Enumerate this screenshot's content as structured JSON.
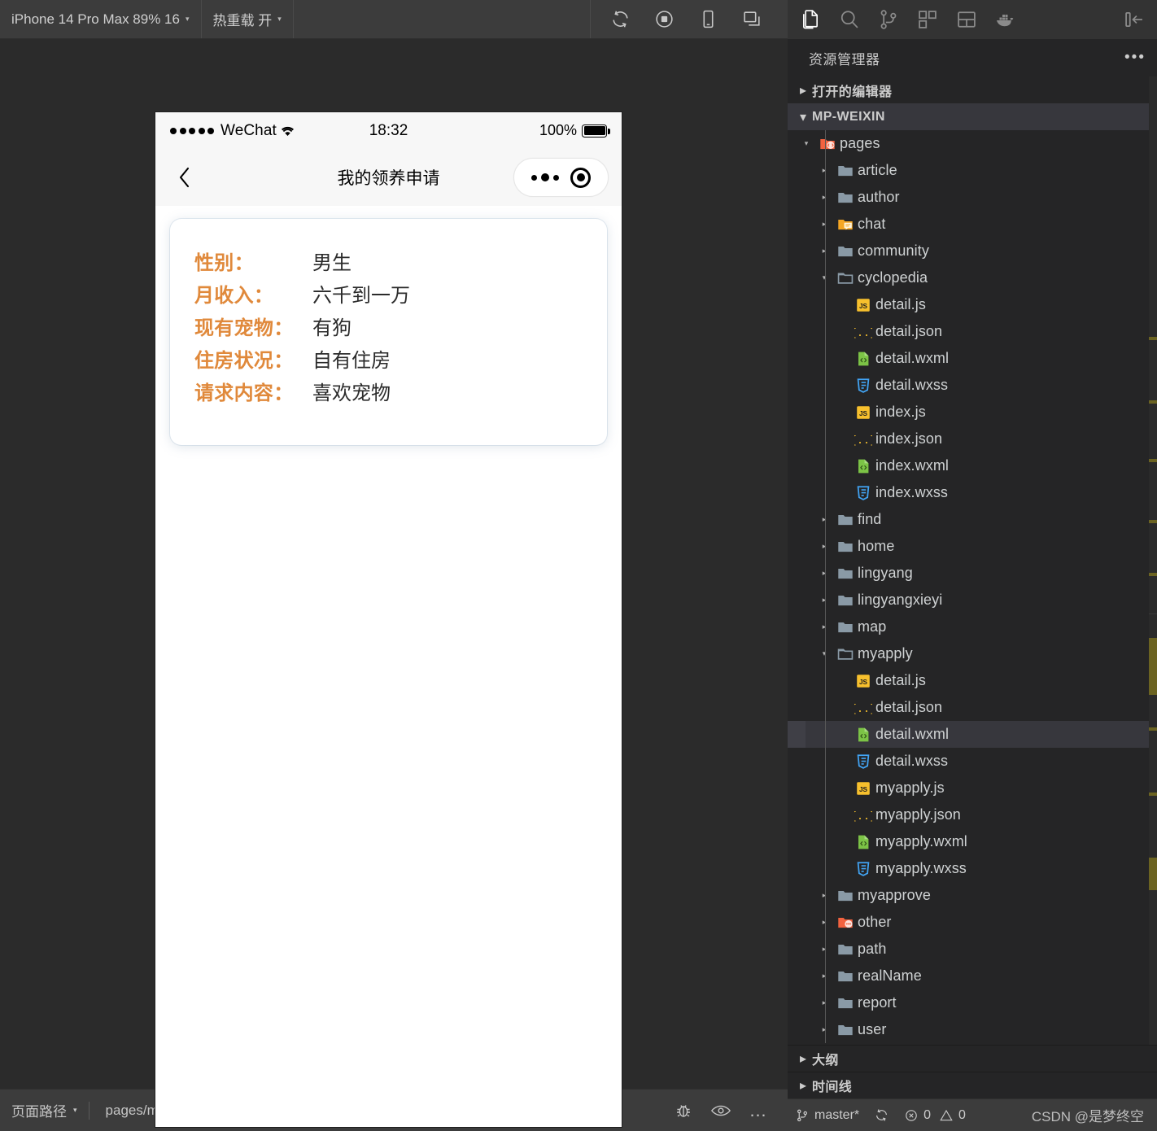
{
  "simulator": {
    "toolbar": {
      "device_label": "iPhone 14 Pro Max 89% 16",
      "hotreload_label": "热重载 开",
      "caret": "▾",
      "icons": [
        {
          "name": "refresh-icon",
          "glyph": "refresh"
        },
        {
          "name": "stop-recording-icon",
          "glyph": "stop"
        },
        {
          "name": "device-preview-icon",
          "glyph": "phone"
        },
        {
          "name": "multi-window-icon",
          "glyph": "windows"
        }
      ]
    },
    "phone": {
      "status_bar": {
        "carrier": "WeChat",
        "time": "18:32",
        "battery_percent": "100%"
      },
      "nav_bar": {
        "title": "我的领养申请"
      },
      "card": {
        "rows": [
          {
            "label": "性别：",
            "value": "男生"
          },
          {
            "label": "月收入：",
            "value": "六千到一万"
          },
          {
            "label": "现有宠物：",
            "value": "有狗"
          },
          {
            "label": "住房状况：",
            "value": "自有住房"
          },
          {
            "label": "请求内容：",
            "value": "喜欢宠物"
          }
        ],
        "label_color": "#e0893b",
        "value_color": "#2b2b2b"
      }
    },
    "status_bar": {
      "page_path_label": "页面路径",
      "caret": "▾",
      "page_path_value": "pages/myapply/myapply",
      "icons": [
        {
          "name": "debug-bug-icon"
        },
        {
          "name": "eye-visibility-icon"
        },
        {
          "name": "more-options-icon",
          "glyph": "…"
        }
      ]
    }
  },
  "vscode": {
    "activity_bar": {
      "items": [
        {
          "name": "explorer-icon",
          "active": true
        },
        {
          "name": "search-icon",
          "active": false
        },
        {
          "name": "source-control-icon",
          "active": false
        },
        {
          "name": "extensions-icon",
          "active": false
        },
        {
          "name": "split-layout-icon",
          "active": false
        },
        {
          "name": "docker-icon",
          "active": false
        }
      ],
      "collapse_icon": "collapse-panel-icon"
    },
    "explorer": {
      "title": "资源管理器",
      "more_glyph": "•••",
      "open_editors_label": "打开的编辑器",
      "workspace_label": "MP-WEIXIN",
      "outline_label": "大纲",
      "timeline_label": "时间线"
    },
    "tree": [
      {
        "depth": 1,
        "label": "pages",
        "kind": "folder",
        "icon": "folder-pages",
        "expanded": true
      },
      {
        "depth": 2,
        "label": "article",
        "kind": "folder",
        "icon": "folder",
        "expanded": false
      },
      {
        "depth": 2,
        "label": "author",
        "kind": "folder",
        "icon": "folder",
        "expanded": false
      },
      {
        "depth": 2,
        "label": "chat",
        "kind": "folder",
        "icon": "folder-chat",
        "expanded": false
      },
      {
        "depth": 2,
        "label": "community",
        "kind": "folder",
        "icon": "folder",
        "expanded": false
      },
      {
        "depth": 2,
        "label": "cyclopedia",
        "kind": "folder",
        "icon": "folder-open",
        "expanded": true
      },
      {
        "depth": 3,
        "label": "detail.js",
        "kind": "file",
        "icon": "js"
      },
      {
        "depth": 3,
        "label": "detail.json",
        "kind": "file",
        "icon": "json"
      },
      {
        "depth": 3,
        "label": "detail.wxml",
        "kind": "file",
        "icon": "wxml"
      },
      {
        "depth": 3,
        "label": "detail.wxss",
        "kind": "file",
        "icon": "wxss"
      },
      {
        "depth": 3,
        "label": "index.js",
        "kind": "file",
        "icon": "js"
      },
      {
        "depth": 3,
        "label": "index.json",
        "kind": "file",
        "icon": "json"
      },
      {
        "depth": 3,
        "label": "index.wxml",
        "kind": "file",
        "icon": "wxml"
      },
      {
        "depth": 3,
        "label": "index.wxss",
        "kind": "file",
        "icon": "wxss"
      },
      {
        "depth": 2,
        "label": "find",
        "kind": "folder",
        "icon": "folder",
        "expanded": false
      },
      {
        "depth": 2,
        "label": "home",
        "kind": "folder",
        "icon": "folder",
        "expanded": false
      },
      {
        "depth": 2,
        "label": "lingyang",
        "kind": "folder",
        "icon": "folder",
        "expanded": false
      },
      {
        "depth": 2,
        "label": "lingyangxieyi",
        "kind": "folder",
        "icon": "folder",
        "expanded": false
      },
      {
        "depth": 2,
        "label": "map",
        "kind": "folder",
        "icon": "folder",
        "expanded": false
      },
      {
        "depth": 2,
        "label": "myapply",
        "kind": "folder",
        "icon": "folder-open",
        "expanded": true
      },
      {
        "depth": 3,
        "label": "detail.js",
        "kind": "file",
        "icon": "js"
      },
      {
        "depth": 3,
        "label": "detail.json",
        "kind": "file",
        "icon": "json"
      },
      {
        "depth": 3,
        "label": "detail.wxml",
        "kind": "file",
        "icon": "wxml",
        "selected": true
      },
      {
        "depth": 3,
        "label": "detail.wxss",
        "kind": "file",
        "icon": "wxss"
      },
      {
        "depth": 3,
        "label": "myapply.js",
        "kind": "file",
        "icon": "js"
      },
      {
        "depth": 3,
        "label": "myapply.json",
        "kind": "file",
        "icon": "json"
      },
      {
        "depth": 3,
        "label": "myapply.wxml",
        "kind": "file",
        "icon": "wxml"
      },
      {
        "depth": 3,
        "label": "myapply.wxss",
        "kind": "file",
        "icon": "wxss"
      },
      {
        "depth": 2,
        "label": "myapprove",
        "kind": "folder",
        "icon": "folder",
        "expanded": false
      },
      {
        "depth": 2,
        "label": "other",
        "kind": "folder",
        "icon": "folder-other",
        "expanded": false
      },
      {
        "depth": 2,
        "label": "path",
        "kind": "folder",
        "icon": "folder",
        "expanded": false
      },
      {
        "depth": 2,
        "label": "realName",
        "kind": "folder",
        "icon": "folder",
        "expanded": false
      },
      {
        "depth": 2,
        "label": "report",
        "kind": "folder",
        "icon": "folder",
        "expanded": false
      },
      {
        "depth": 2,
        "label": "user",
        "kind": "folder",
        "icon": "folder",
        "expanded": false
      }
    ],
    "status_bar": {
      "branch": "master*",
      "errors": "0",
      "warnings": "0",
      "watermark": "CSDN @是梦终空"
    }
  },
  "colors": {
    "accent_orange": "#e0893b",
    "toolbar_bg": "#3c3c3c",
    "sim_bg": "#2b2b2b",
    "vs_sidebar_bg": "#252526",
    "vs_activity_bg": "#333333",
    "selection_bg": "#37373d"
  }
}
